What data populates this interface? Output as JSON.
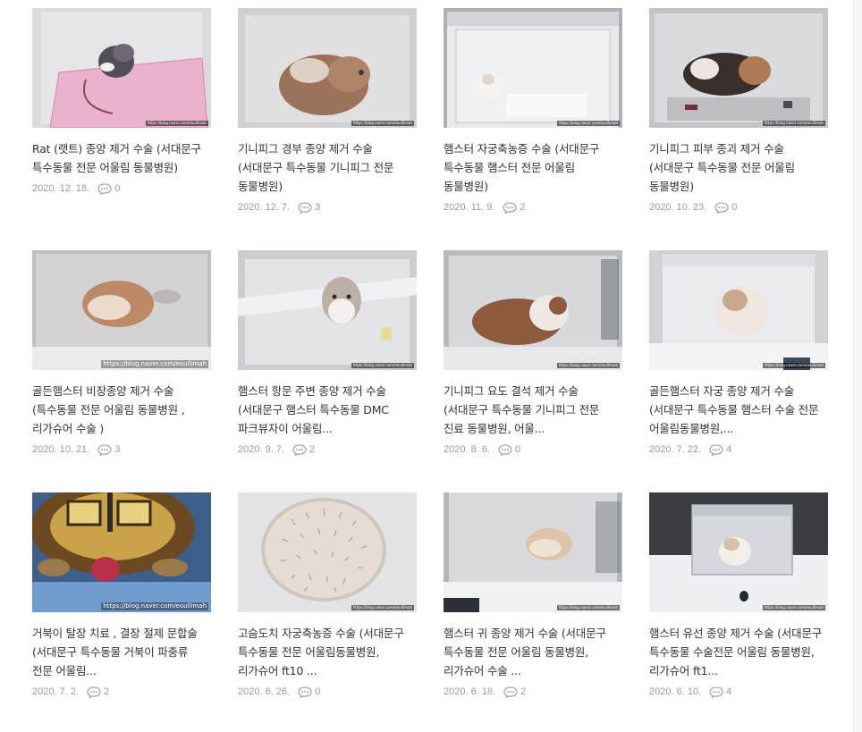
{
  "posts": [
    {
      "title": "Rat (랫트) 종양 제거 수술 (서대문구 특수동물 전문 어울림 동물병원)",
      "date": "2020. 12. 18.",
      "comments": "0",
      "watermark": "https://blog.naver.com/eoullimah",
      "thumb_icon": "rat-in-box-photo"
    },
    {
      "title": "기니피그 경부 종양 제거 수술 (서대문구 특수동물 기니피그 전문 동물병원)",
      "date": "2020. 12. 7.",
      "comments": "3",
      "watermark": "https://blog.naver.com/eoullimah",
      "thumb_icon": "guinea-pig-in-box-photo"
    },
    {
      "title": "햄스터 자궁축농증 수술 (서대문구 특수동물 햄스터 전문 어울림 동물병원)",
      "date": "2020. 11. 9.",
      "comments": "2",
      "watermark": "https://blog.naver.com/eoullimah",
      "thumb_icon": "hamster-in-box-photo"
    },
    {
      "title": "기니피그 피부 종괴 제거 수술 (서대문구 특수동물 전문 어울림 동물병원)",
      "date": "2020. 10. 23.",
      "comments": "0",
      "watermark": "https://blog.naver.com/eoullimah",
      "thumb_icon": "guinea-pig-in-box-photo"
    },
    {
      "title": "골든햄스터 비장종양 제거 수술 (특수동물 전문 어울림 동물병원 , 리가슈어 수술 )",
      "date": "2020. 10. 21.",
      "comments": "3",
      "watermark": "https://blog.naver.com/eoullimah",
      "thumb_icon": "golden-hamster-in-box-photo"
    },
    {
      "title": "햄스터 항문 주변 종양 제거 수술 (서대문구 햄스터 특수동물 DMC 파크뷰자이 어울림...",
      "date": "2020. 9. 7.",
      "comments": "2",
      "watermark": "https://blog.naver.com/eoullimah",
      "thumb_icon": "hamster-in-box-photo"
    },
    {
      "title": "기니피그 요도 결석 제거 수술 (서대문구 특수동물 기니피그 전문 진료 동물병원, 어울...",
      "date": "2020. 8. 6.",
      "comments": "0",
      "watermark": "https://blog.naver.com/eoullimah",
      "thumb_icon": "guinea-pig-in-box-photo"
    },
    {
      "title": "골든햄스터 자궁 종양 제거 수술 (서대문구 특수동물 햄스터 수술 전문 어울림동물병원,...",
      "date": "2020. 7. 22.",
      "comments": "4",
      "watermark": "https://blog.naver.com/eoullimah",
      "thumb_icon": "golden-hamster-in-box-photo"
    },
    {
      "title": "거북이 탈장 치료 , 결장 절제 문합술 (서대문구 특수동물 거북이 파충류 전문 어울림...",
      "date": "2020. 7. 2.",
      "comments": "2",
      "watermark": "https://blog.naver.com/eoullimah",
      "thumb_icon": "tortoise-photo"
    },
    {
      "title": "고슴도치 자궁축농증 수술 (서대문구 특수동물 전문 어울림동물병원, 리가슈어 ft10 ...",
      "date": "2020. 6. 26.",
      "comments": "0",
      "watermark": "https://blog.naver.com/eoullimah",
      "thumb_icon": "hedgehog-photo"
    },
    {
      "title": "햄스터 귀 종양 제거 수술 (서대문구 특수동물 전문 어울림 동물병원, 리가슈어 수술 ...",
      "date": "2020. 6. 18.",
      "comments": "2",
      "watermark": "https://blog.naver.com/eoullimah",
      "thumb_icon": "hamster-in-box-photo"
    },
    {
      "title": "햄스터 유선 종양 제거 수술 (서대문구 특수동물 수술전문 어울림 동물병원, 리가슈어 ft1...",
      "date": "2020. 6. 10.",
      "comments": "4",
      "watermark": "https://blog.naver.com/eoullimah",
      "thumb_icon": "hamster-in-box-photo"
    }
  ],
  "colors": {
    "title_text": "#333333",
    "meta_text": "#9a9a9a",
    "background": "#ffffff"
  }
}
